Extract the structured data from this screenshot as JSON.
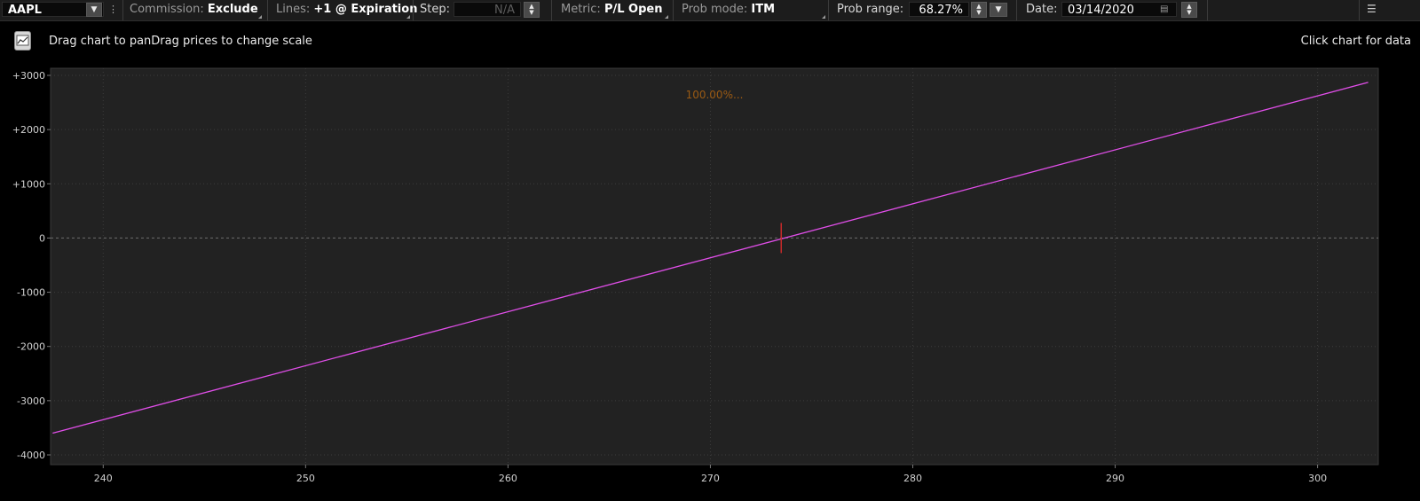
{
  "toolbar": {
    "symbol": "AAPL",
    "commission_label": "Commission:",
    "commission_value": "Exclude",
    "lines_label": "Lines:",
    "lines_value": "+1 @ Expiration",
    "step_label": "Step:",
    "step_value": "N/A",
    "metric_label": "Metric:",
    "metric_value": "P/L Open",
    "prob_mode_label": "Prob mode:",
    "prob_mode_value": "ITM",
    "prob_range_label": "Prob range:",
    "prob_range_value": "68.27%",
    "date_label": "Date:",
    "date_value": "03/14/2020"
  },
  "subheader": {
    "hint": "Drag chart to panDrag prices to change scale",
    "click_hint": "Click chart for data"
  },
  "icons": {
    "dropdown": "chevron-down-icon",
    "spinner": "spinner-icon",
    "calendar": "calendar-icon",
    "menu": "menu-icon",
    "chart": "chart-icon"
  },
  "colors": {
    "line": "#e04ee8",
    "marker": "#c62a2a",
    "prob_text": "#9a5a14",
    "plot_bg": "#222222"
  },
  "chart_data": {
    "type": "line",
    "prob_label": "100.00%...",
    "x": [
      237.5,
      302.5
    ],
    "series": [
      {
        "values": [
          -3600,
          2870
        ]
      }
    ],
    "current_price": 273.5,
    "xlim": [
      237.4,
      303
    ],
    "ylim": [
      -4000,
      3000
    ],
    "x_ticks": [
      240,
      250,
      260,
      270,
      280,
      290,
      300
    ],
    "x_tick_labels": [
      "240",
      "250",
      "260",
      "270",
      "280",
      "290",
      "300"
    ],
    "y_ticks": [
      3000,
      2000,
      1000,
      0,
      -1000,
      -2000,
      -3000,
      -4000
    ],
    "y_tick_labels": [
      "+3000",
      "+2000",
      "+1000",
      "0",
      "-1000",
      "-2000",
      "-3000",
      "-4000"
    ],
    "grid": true
  }
}
